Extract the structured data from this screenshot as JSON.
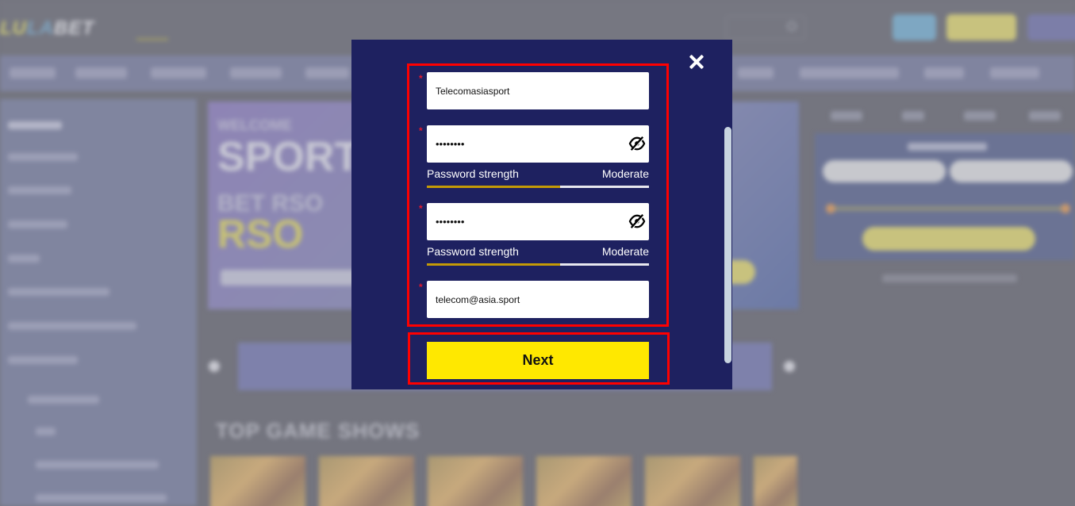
{
  "background": {
    "logo": {
      "part1": "LU",
      "part2": "LA",
      "part3": "BET"
    },
    "section_title": "TOP GAME SHOWS"
  },
  "modal": {
    "fields": [
      {
        "type": "text",
        "value": "Telecomasiasport",
        "required_mark": "*"
      },
      {
        "type": "password",
        "value": "12345678",
        "required_mark": "*",
        "toggle_icon": "eye-slash-icon",
        "strength": {
          "label": "Password strength",
          "level": "Moderate",
          "percent": 60
        }
      },
      {
        "type": "password",
        "value": "12345678",
        "required_mark": "*",
        "toggle_icon": "eye-slash-icon",
        "strength": {
          "label": "Password strength",
          "level": "Moderate",
          "percent": 60
        }
      },
      {
        "type": "email",
        "value": "telecom@asia.sport",
        "required_mark": "*"
      }
    ],
    "next_label": "Next",
    "close_icon": "close-icon"
  },
  "colors": {
    "modal_bg": "#1e2160",
    "highlight": "#ff0000",
    "next_button": "#ffe800",
    "strength_fill": "#c49a06",
    "required": "#e0182d"
  }
}
